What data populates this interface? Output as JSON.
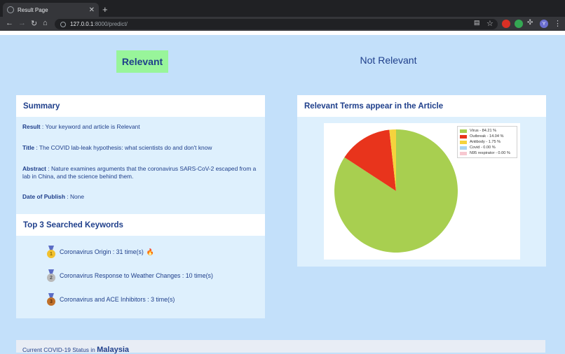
{
  "browser": {
    "tab_title": "Result Page",
    "tab_close": "✕",
    "new_tab": "+",
    "url_host": "127.0.0.1",
    "url_path": ":8000/predict/",
    "profile_initial": "Y"
  },
  "page": {
    "relevant_label": "Relevant",
    "not_relevant_label": "Not Relevant",
    "summary": {
      "title": "Summary",
      "result_label": "Result",
      "result_value": " : Your keyword and article is Relevant",
      "title_label": "Title",
      "title_value": " : The COVID lab-leak hypothesis: what scientists do and don't know",
      "abstract_label": "Abstract",
      "abstract_value": " : Nature examines arguments that the coronavirus SARS-CoV-2 escaped from a lab in China, and the science behind them.",
      "date_label": "Date of Publish",
      "date_value": " : None"
    },
    "keywords": {
      "title": "Top 3 Searched Keywords",
      "items": [
        {
          "text": "Coronavirus Origin : 31 time(s)",
          "medal_color": "#f2c12e",
          "medal_text": "1"
        },
        {
          "text": "Coronavirus Response to Weather Changes : 10 time(s)",
          "medal_color": "#b9b9b9",
          "medal_text": "2"
        },
        {
          "text": "Coronavirus and ACE Inhibitors : 3 time(s)",
          "medal_color": "#c0702a",
          "medal_text": "3"
        }
      ],
      "fire_icon": "🔥"
    },
    "chart_card_title": "Relevant Terms appear in the Article",
    "covid": {
      "prefix": "Current COVID-19 Status in ",
      "country": "Malaysia"
    }
  },
  "chart_data": {
    "type": "pie",
    "categories": [
      "Virus - 84.21 %",
      "Outbreak - 14.04 %",
      "Antibody - 1.75 %",
      "Covid - 0.00 %",
      "N95 respirator - 0.00 %"
    ],
    "values": [
      84.21,
      14.04,
      1.75,
      0.0,
      0.0
    ],
    "colors": [
      "#a8cf50",
      "#e8341c",
      "#f5d33d",
      "#a8d4f0",
      "#f7c8d0"
    ],
    "legend_position": "top-right"
  }
}
